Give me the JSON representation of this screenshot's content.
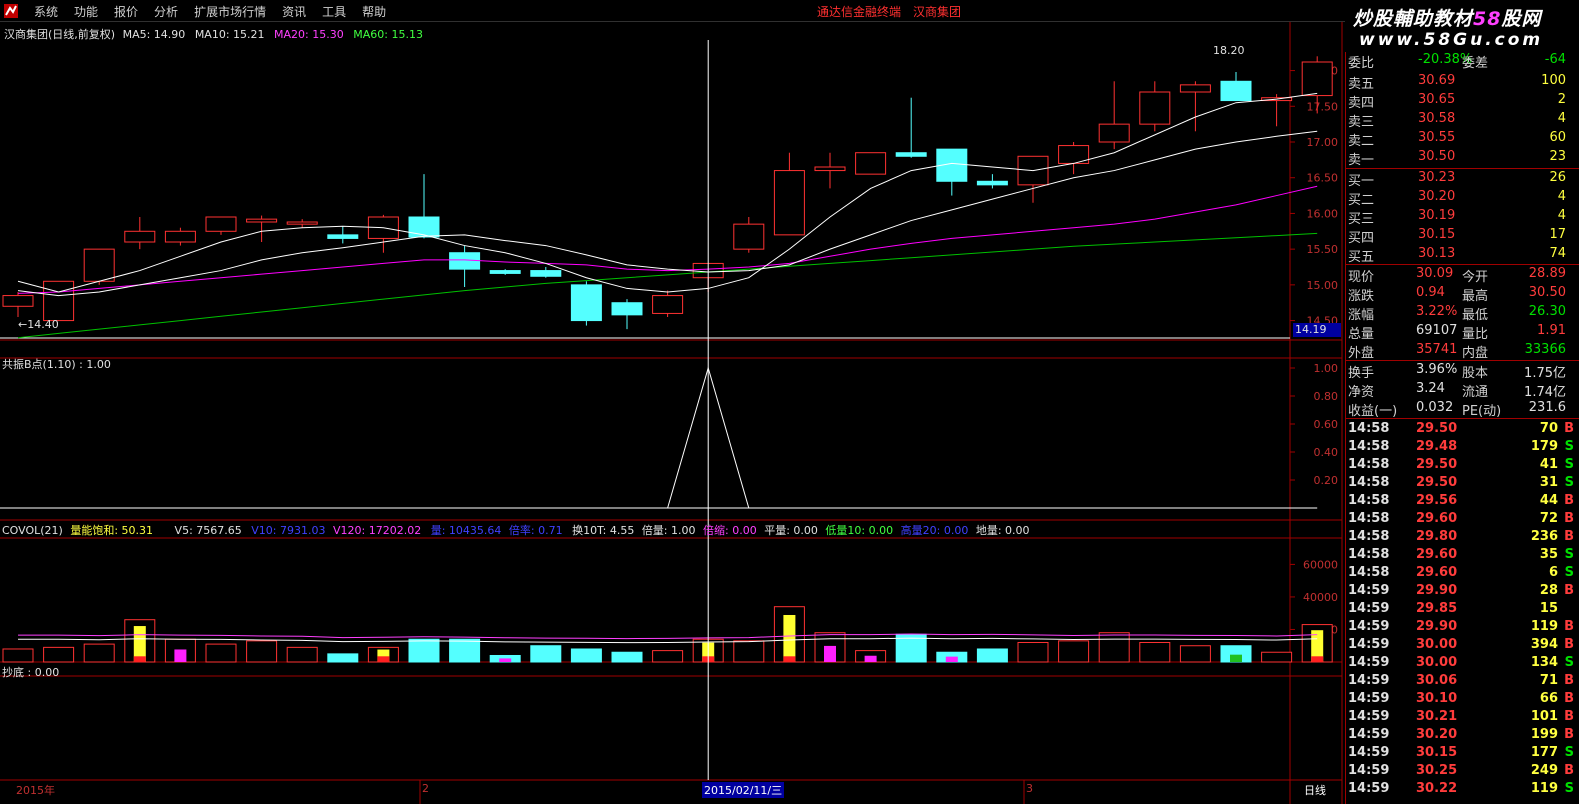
{
  "menu": {
    "items": [
      "系统",
      "功能",
      "报价",
      "分析",
      "扩展市场行情",
      "资讯",
      "工具",
      "帮助"
    ],
    "center_app": "通达信金融终端",
    "center_stock": "汉商集团"
  },
  "watermark": {
    "title_a": "炒股輔助教材",
    "title_b": "58",
    "title_c": "股网",
    "url": "www.58Gu.com"
  },
  "main_pane": {
    "title": "汉商集团(日线,前复权)",
    "ma5": "MA5: 14.90",
    "ma10": "MA10: 15.21",
    "ma20": "MA20: 15.30",
    "ma60": "MA60: 15.13",
    "high_label": "18.20",
    "low_label": "14.40",
    "current_price_tag": "14.19",
    "y_ticks": [
      "18.00",
      "17.50",
      "17.00",
      "16.50",
      "16.00",
      "15.50",
      "15.00",
      "14.50"
    ]
  },
  "indicator_pane": {
    "title": "共振B点(1.10) : 1.00",
    "y_ticks": [
      "1.00",
      "0.80",
      "0.60",
      "0.40",
      "0.20"
    ]
  },
  "volume_pane": {
    "name": "COVOL(21)",
    "sat": "量能饱和: 50.31",
    "v5": "V5: 7567.65",
    "v10": "V10: 7931.03",
    "v120": "V120: 17202.02",
    "hand": "量: 10435.64",
    "ratio": "倍率: 0.71",
    "hs": "换10T: 4.55",
    "bl": "倍量: 1.00",
    "bs": "倍缩: 0.00",
    "pl": "平量: 0.00",
    "dl": "低量10: 0.00",
    "gl": "高量20: 0.00",
    "ground": "地量: 0.00",
    "y_ticks": [
      "60000",
      "40000",
      "20000"
    ]
  },
  "bottom_pane": {
    "title": "抄底 : 0.00"
  },
  "x_axis": {
    "year": "2015年",
    "m2": "2",
    "cursor_date": "2015/02/11/三",
    "m3": "3",
    "period": "日线"
  },
  "chart_data": {
    "type": "candlestick",
    "ylim": [
      14.2,
      18.4
    ],
    "candles": [
      [
        14.7,
        14.85,
        14.55,
        14.9
      ],
      [
        14.5,
        15.05,
        14.5,
        15.05
      ],
      [
        15.05,
        15.5,
        15.0,
        15.5
      ],
      [
        15.6,
        15.75,
        15.5,
        15.95
      ],
      [
        15.6,
        15.75,
        15.55,
        15.8
      ],
      [
        15.75,
        15.95,
        15.7,
        15.95
      ],
      [
        15.88,
        15.92,
        15.6,
        15.97
      ],
      [
        15.85,
        15.88,
        15.8,
        15.92
      ],
      [
        15.7,
        15.65,
        15.58,
        15.82
      ],
      [
        15.65,
        15.95,
        15.45,
        15.98
      ],
      [
        15.95,
        15.67,
        15.65,
        16.55
      ],
      [
        15.45,
        15.22,
        14.97,
        15.55
      ],
      [
        15.2,
        15.16,
        15.14,
        15.22
      ],
      [
        15.2,
        15.12,
        15.1,
        15.25
      ],
      [
        15.0,
        14.5,
        14.43,
        15.05
      ],
      [
        14.75,
        14.58,
        14.38,
        14.8
      ],
      [
        14.6,
        14.85,
        14.55,
        14.92
      ],
      [
        15.1,
        15.3,
        14.9,
        15.3
      ],
      [
        15.5,
        15.85,
        15.45,
        15.95
      ],
      [
        15.7,
        16.6,
        15.7,
        16.85
      ],
      [
        16.6,
        16.65,
        16.35,
        16.85
      ],
      [
        16.55,
        16.85,
        16.55,
        16.85
      ],
      [
        16.85,
        16.8,
        16.78,
        17.62
      ],
      [
        16.9,
        16.45,
        16.25,
        16.9
      ],
      [
        16.45,
        16.4,
        16.35,
        16.55
      ],
      [
        16.4,
        16.8,
        16.15,
        16.8
      ],
      [
        16.7,
        16.95,
        16.55,
        17.0
      ],
      [
        17.0,
        17.25,
        16.9,
        17.85
      ],
      [
        17.25,
        17.7,
        17.15,
        17.85
      ],
      [
        17.7,
        17.8,
        17.15,
        17.85
      ],
      [
        17.85,
        17.58,
        17.58,
        17.98
      ],
      [
        17.58,
        17.62,
        17.22,
        17.67
      ],
      [
        17.65,
        18.12,
        17.4,
        18.2
      ]
    ],
    "ma5": [
      15.05,
      14.9,
      15.05,
      15.2,
      15.4,
      15.6,
      15.75,
      15.8,
      15.82,
      15.8,
      15.7,
      15.55,
      15.45,
      15.3,
      15.1,
      14.95,
      14.9,
      14.95,
      15.1,
      15.5,
      15.95,
      16.35,
      16.6,
      16.7,
      16.65,
      16.6,
      16.7,
      16.85,
      17.1,
      17.35,
      17.55,
      17.6,
      17.68
    ],
    "ma10": [
      14.92,
      14.85,
      14.9,
      15.0,
      15.1,
      15.2,
      15.35,
      15.45,
      15.52,
      15.6,
      15.68,
      15.7,
      15.62,
      15.55,
      15.42,
      15.28,
      15.22,
      15.18,
      15.2,
      15.28,
      15.5,
      15.7,
      15.9,
      16.05,
      16.2,
      16.35,
      16.5,
      16.6,
      16.75,
      16.9,
      17.0,
      17.08,
      17.15
    ],
    "ma20": [
      14.88,
      14.9,
      14.95,
      15.0,
      15.05,
      15.1,
      15.15,
      15.2,
      15.25,
      15.3,
      15.35,
      15.35,
      15.32,
      15.3,
      15.28,
      15.22,
      15.2,
      15.22,
      15.25,
      15.3,
      15.4,
      15.5,
      15.58,
      15.65,
      15.7,
      15.75,
      15.8,
      15.85,
      15.92,
      16.02,
      16.12,
      16.25,
      16.38
    ],
    "ma60": [
      14.26,
      14.32,
      14.38,
      14.44,
      14.5,
      14.56,
      14.62,
      14.68,
      14.74,
      14.8,
      14.86,
      14.92,
      14.97,
      15.02,
      15.06,
      15.1,
      15.14,
      15.18,
      15.22,
      15.26,
      15.3,
      15.34,
      15.38,
      15.42,
      15.46,
      15.5,
      15.54,
      15.57,
      15.6,
      15.63,
      15.66,
      15.69,
      15.72
    ],
    "indicator": [
      0,
      0,
      0,
      0,
      0,
      0,
      0,
      0,
      0,
      0,
      0,
      0,
      0,
      0,
      0,
      0,
      0,
      1,
      0,
      0,
      0,
      0,
      0,
      0,
      0,
      0,
      0,
      0,
      0,
      0,
      0,
      0,
      0
    ],
    "volume_ylim": [
      0,
      75000
    ],
    "volume": [
      8000,
      9000,
      11000,
      26000,
      14000,
      11000,
      13000,
      9000,
      5000,
      9000,
      14000,
      14000,
      4000,
      10000,
      8000,
      6000,
      7000,
      14000,
      13000,
      34000,
      18000,
      7000,
      17000,
      6000,
      8000,
      12000,
      13000,
      18000,
      12000,
      10000,
      10000,
      6000,
      23000
    ],
    "volume_ma": [
      16500,
      16500,
      16200,
      16800,
      16500,
      16400,
      16000,
      15800,
      15000,
      15200,
      15500,
      15300,
      14900,
      14700,
      14600,
      14400,
      14500,
      14800,
      15000,
      16000,
      16800,
      16800,
      17200,
      16800,
      17000,
      16700,
      16300,
      16600,
      16600,
      16400,
      16300,
      16000,
      16800
    ]
  },
  "quote_panel": {
    "top": {
      "l1": "委比",
      "v1": "-20.38%",
      "l2": "委差",
      "v2": "-64"
    },
    "asks": [
      {
        "label": "卖五",
        "price": "30.69",
        "vol": "100"
      },
      {
        "label": "卖四",
        "price": "30.65",
        "vol": "2"
      },
      {
        "label": "卖三",
        "price": "30.58",
        "vol": "4"
      },
      {
        "label": "卖二",
        "price": "30.55",
        "vol": "60"
      },
      {
        "label": "卖一",
        "price": "30.50",
        "vol": "23"
      }
    ],
    "bids": [
      {
        "label": "买一",
        "price": "30.23",
        "vol": "26"
      },
      {
        "label": "买二",
        "price": "30.20",
        "vol": "4"
      },
      {
        "label": "买三",
        "price": "30.19",
        "vol": "4"
      },
      {
        "label": "买四",
        "price": "30.15",
        "vol": "17"
      },
      {
        "label": "买五",
        "price": "30.13",
        "vol": "74"
      }
    ],
    "stats": [
      {
        "l1": "现价",
        "v1": "30.09",
        "l2": "今开",
        "v2": "28.89",
        "c1": "red",
        "c2": "red"
      },
      {
        "l1": "涨跌",
        "v1": "0.94",
        "l2": "最高",
        "v2": "30.50",
        "c1": "red",
        "c2": "red"
      },
      {
        "l1": "涨幅",
        "v1": "3.22%",
        "l2": "最低",
        "v2": "26.30",
        "c1": "red",
        "c2": "green"
      },
      {
        "l1": "总量",
        "v1": "69107",
        "l2": "量比",
        "v2": "1.91",
        "c1": "white",
        "c2": "red"
      },
      {
        "l1": "外盘",
        "v1": "35741",
        "l2": "内盘",
        "v2": "33366",
        "c1": "red",
        "c2": "green"
      }
    ],
    "fundamentals": [
      {
        "l1": "换手",
        "v1": "3.96%",
        "l2": "股本",
        "v2": "1.75亿"
      },
      {
        "l1": "净资",
        "v1": "3.24",
        "l2": "流通",
        "v2": "1.74亿"
      },
      {
        "l1": "收益(一)",
        "v1": "0.032",
        "l2": "PE(动)",
        "v2": "231.6"
      }
    ],
    "ticks": [
      {
        "t": "14:58",
        "p": "29.50",
        "v": "70",
        "f": "B"
      },
      {
        "t": "14:58",
        "p": "29.48",
        "v": "179",
        "f": "S"
      },
      {
        "t": "14:58",
        "p": "29.50",
        "v": "41",
        "f": "S"
      },
      {
        "t": "14:58",
        "p": "29.50",
        "v": "31",
        "f": "S"
      },
      {
        "t": "14:58",
        "p": "29.56",
        "v": "44",
        "f": "B"
      },
      {
        "t": "14:58",
        "p": "29.60",
        "v": "72",
        "f": "B"
      },
      {
        "t": "14:58",
        "p": "29.80",
        "v": "236",
        "f": "B"
      },
      {
        "t": "14:58",
        "p": "29.60",
        "v": "35",
        "f": "S"
      },
      {
        "t": "14:58",
        "p": "29.60",
        "v": "6",
        "f": "S"
      },
      {
        "t": "14:59",
        "p": "29.90",
        "v": "28",
        "f": "B"
      },
      {
        "t": "14:59",
        "p": "29.85",
        "v": "15",
        "f": ""
      },
      {
        "t": "14:59",
        "p": "29.90",
        "v": "119",
        "f": "B"
      },
      {
        "t": "14:59",
        "p": "30.00",
        "v": "394",
        "f": "B"
      },
      {
        "t": "14:59",
        "p": "30.00",
        "v": "134",
        "f": "S"
      },
      {
        "t": "14:59",
        "p": "30.06",
        "v": "71",
        "f": "B"
      },
      {
        "t": "14:59",
        "p": "30.10",
        "v": "66",
        "f": "B"
      },
      {
        "t": "14:59",
        "p": "30.21",
        "v": "101",
        "f": "B"
      },
      {
        "t": "14:59",
        "p": "30.20",
        "v": "199",
        "f": "B"
      },
      {
        "t": "14:59",
        "p": "30.15",
        "v": "177",
        "f": "S"
      },
      {
        "t": "14:59",
        "p": "30.25",
        "v": "249",
        "f": "B"
      },
      {
        "t": "14:59",
        "p": "30.22",
        "v": "119",
        "f": "S"
      }
    ]
  },
  "colors": {
    "up": "#ff3232",
    "down": "#54ffff",
    "ma5": "#ffffff",
    "ma10": "#ffffff",
    "ma20": "#ff00ff",
    "ma60": "#00c000",
    "frame": "#a00000"
  }
}
